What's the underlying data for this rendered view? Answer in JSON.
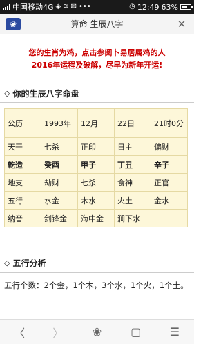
{
  "statusbar": {
    "carrier": "中国移动4G",
    "time": "12:49",
    "battery": "63%",
    "battery_level": 0.63
  },
  "titlebar": {
    "title": "算命 生辰八字"
  },
  "notice": {
    "line1": "您的生肖为鸡，点击参阅卜易居属鸡的人",
    "line2": "2016年运程及破解，尽早为新年开运!"
  },
  "bazi_section": {
    "heading": "你的生辰八字命盘",
    "rows": [
      [
        "公历",
        "1993年",
        "12月",
        "22日",
        "21时0分"
      ],
      [
        "天干",
        "七杀",
        "正印",
        "日主",
        "偏财"
      ],
      [
        "乾造",
        "癸酉",
        "甲子",
        "丁丑",
        "辛子"
      ],
      [
        "地支",
        "劫财",
        "七杀",
        "食神",
        "正官"
      ],
      [
        "五行",
        "水金",
        "木水",
        "火土",
        "金水"
      ],
      [
        "纳音",
        "剑锋金",
        "海中金",
        "涧下水",
        ""
      ]
    ]
  },
  "wuxing_section": {
    "heading": "五行分析",
    "text": "五行个数：2个金，1个木，3个水，1个火，1个土。"
  },
  "icons": {
    "logo": "paw-icon",
    "close": "close-icon",
    "back": "chevron-left-icon",
    "forward": "chevron-right-icon",
    "home": "paw-icon",
    "tabs": "square-icon",
    "menu": "menu-icon"
  }
}
